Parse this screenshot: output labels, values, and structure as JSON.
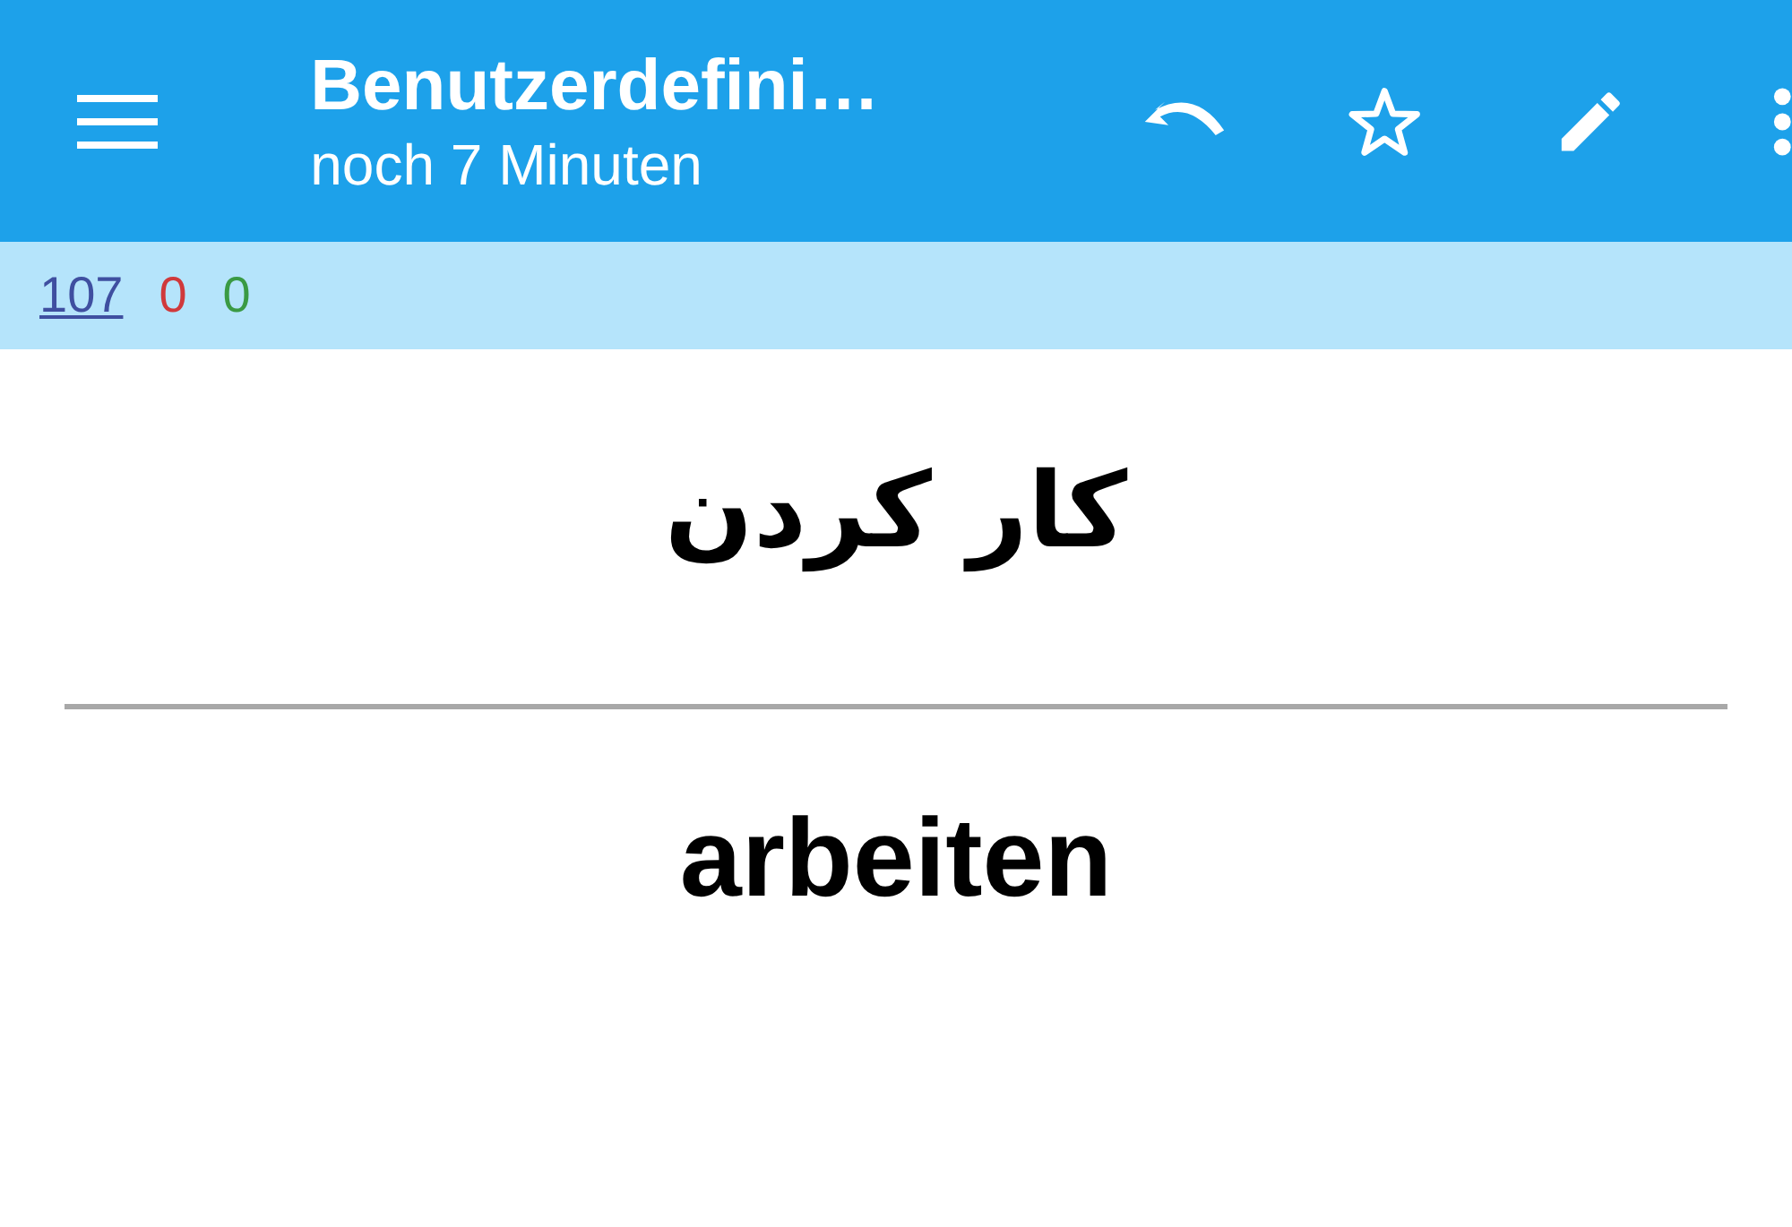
{
  "toolbar": {
    "title": "Benutzerdefini…",
    "subtitle": "noch 7 Minuten"
  },
  "counts": [
    {
      "text": "107",
      "color": "#3f4fa0",
      "underlined": true
    },
    {
      "text": "0",
      "color": "#d0393b",
      "underlined": false
    },
    {
      "text": "0",
      "color": "#3a9a44",
      "underlined": false
    }
  ],
  "card": {
    "question": "کار کردن",
    "answer": "arbeiten"
  }
}
